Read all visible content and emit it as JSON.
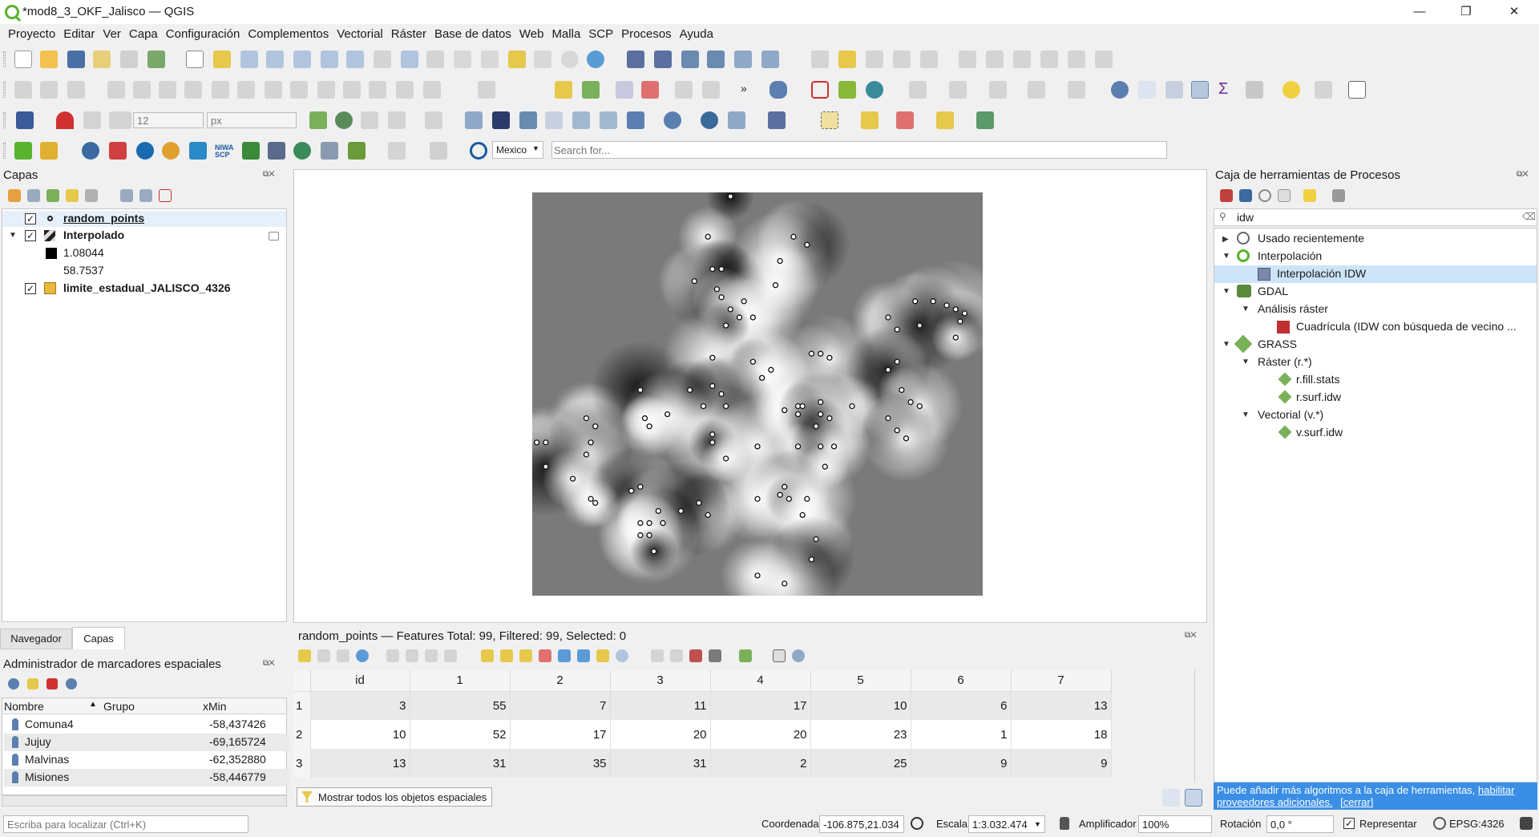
{
  "window": {
    "title": "*mod8_3_OKF_Jalisco — QGIS",
    "controls": [
      "—",
      "❐",
      "✕"
    ]
  },
  "menu": [
    "Proyecto",
    "Editar",
    "Ver",
    "Capa",
    "Configuración",
    "Complementos",
    "Vectorial",
    "Ráster",
    "Base de datos",
    "Web",
    "Malla",
    "SCP",
    "Procesos",
    "Ayuda"
  ],
  "toolbar": {
    "size_value": "12",
    "unit_value": "px",
    "locator_region": "Mexico",
    "search_placeholder": "Search for...",
    "overflow": "»"
  },
  "layers_panel": {
    "title": "Capas",
    "layers": [
      {
        "name": "random_points",
        "checked": true,
        "type": "points"
      },
      {
        "name": "Interpolado",
        "checked": true,
        "type": "raster",
        "legend": [
          "1.08044",
          "58.7537"
        ]
      },
      {
        "name": "limite_estadual_JALISCO_4326",
        "checked": true,
        "type": "polygon",
        "color": "#e8b93a"
      }
    ]
  },
  "bottom_tabs": [
    "Navegador",
    "Capas"
  ],
  "bookmarks_panel": {
    "title": "Administrador de marcadores espaciales",
    "columns": [
      "Nombre",
      "Grupo",
      "xMin"
    ],
    "rows": [
      {
        "name": "Comuna4",
        "group": "",
        "xmin": "-58,437426"
      },
      {
        "name": "Jujuy",
        "group": "",
        "xmin": "-69,165724"
      },
      {
        "name": "Malvinas",
        "group": "",
        "xmin": "-62,352880"
      },
      {
        "name": "Misiones",
        "group": "",
        "xmin": "-58,446779"
      }
    ]
  },
  "attribute_table": {
    "title": "random_points — Features Total: 99, Filtered: 99, Selected: 0",
    "columns": [
      "id",
      "1",
      "2",
      "3",
      "4",
      "5",
      "6",
      "7"
    ],
    "rows": [
      {
        "rownum": "1",
        "cells": [
          "3",
          "55",
          "7",
          "11",
          "17",
          "10",
          "6",
          "13"
        ]
      },
      {
        "rownum": "2",
        "cells": [
          "10",
          "52",
          "17",
          "20",
          "20",
          "23",
          "1",
          "18"
        ]
      },
      {
        "rownum": "3",
        "cells": [
          "13",
          "31",
          "35",
          "31",
          "2",
          "25",
          "9",
          "9"
        ]
      }
    ],
    "filter_button": "Mostrar todos los objetos espaciales"
  },
  "processing": {
    "title": "Caja de herramientas de Procesos",
    "search_value": "idw",
    "tree": [
      {
        "label": "Usado recientemente",
        "level": 0,
        "expanded": false
      },
      {
        "label": "Interpolación",
        "level": 0,
        "expanded": true
      },
      {
        "label": "Interpolación IDW",
        "level": 1
      },
      {
        "label": "GDAL",
        "level": 0,
        "expanded": true
      },
      {
        "label": "Análisis ráster",
        "level": 1,
        "expanded": true
      },
      {
        "label": "Cuadrícula (IDW con búsqueda de vecino ...",
        "level": 2
      },
      {
        "label": "GRASS",
        "level": 0,
        "expanded": true
      },
      {
        "label": "Ráster (r.*)",
        "level": 1,
        "expanded": true
      },
      {
        "label": "r.fill.stats",
        "level": 2
      },
      {
        "label": "r.surf.idw",
        "level": 2
      },
      {
        "label": "Vectorial (v.*)",
        "level": 1,
        "expanded": true
      },
      {
        "label": "v.surf.idw",
        "level": 2
      }
    ],
    "notice_text": "Puede añadir más algoritmos a la caja de herramientas,",
    "notice_link1": "habilitar",
    "notice_link2": "proveedores adicionales.",
    "notice_close": "[cerrar]"
  },
  "statusbar": {
    "locator_placeholder": "Escriba para localizar (Ctrl+K)",
    "coord_label": "Coordenada",
    "coord_value": "-106.875,21.034",
    "scale_label": "Escala",
    "scale_value": "1:3.032.474",
    "magnifier_label": "Amplificador",
    "magnifier_value": "100%",
    "rotation_label": "Rotación",
    "rotation_value": "0,0 °",
    "render_label": "Representar",
    "crs": "EPSG:4326"
  },
  "map": {
    "points": [
      [
        0.44,
        0.01
      ],
      [
        0.39,
        0.11
      ],
      [
        0.58,
        0.11
      ],
      [
        0.61,
        0.13
      ],
      [
        0.55,
        0.17
      ],
      [
        0.4,
        0.19
      ],
      [
        0.42,
        0.19
      ],
      [
        0.36,
        0.22
      ],
      [
        0.54,
        0.23
      ],
      [
        0.41,
        0.24
      ],
      [
        0.47,
        0.27
      ],
      [
        0.42,
        0.26
      ],
      [
        0.44,
        0.29
      ],
      [
        0.46,
        0.31
      ],
      [
        0.49,
        0.31
      ],
      [
        0.43,
        0.33
      ],
      [
        0.85,
        0.27
      ],
      [
        0.89,
        0.27
      ],
      [
        0.92,
        0.28
      ],
      [
        0.94,
        0.29
      ],
      [
        0.96,
        0.3
      ],
      [
        0.95,
        0.32
      ],
      [
        0.79,
        0.31
      ],
      [
        0.81,
        0.34
      ],
      [
        0.86,
        0.33
      ],
      [
        0.94,
        0.36
      ],
      [
        0.62,
        0.4
      ],
      [
        0.64,
        0.4
      ],
      [
        0.66,
        0.41
      ],
      [
        0.4,
        0.41
      ],
      [
        0.49,
        0.42
      ],
      [
        0.81,
        0.42
      ],
      [
        0.53,
        0.44
      ],
      [
        0.79,
        0.44
      ],
      [
        0.51,
        0.46
      ],
      [
        0.82,
        0.49
      ],
      [
        0.4,
        0.48
      ],
      [
        0.42,
        0.5
      ],
      [
        0.38,
        0.53
      ],
      [
        0.43,
        0.53
      ],
      [
        0.64,
        0.52
      ],
      [
        0.71,
        0.53
      ],
      [
        0.84,
        0.52
      ],
      [
        0.86,
        0.53
      ],
      [
        0.59,
        0.53
      ],
      [
        0.6,
        0.53
      ],
      [
        0.56,
        0.54
      ],
      [
        0.59,
        0.55
      ],
      [
        0.64,
        0.55
      ],
      [
        0.66,
        0.56
      ],
      [
        0.79,
        0.56
      ],
      [
        0.63,
        0.58
      ],
      [
        0.12,
        0.56
      ],
      [
        0.14,
        0.58
      ],
      [
        0.24,
        0.49
      ],
      [
        0.25,
        0.56
      ],
      [
        0.26,
        0.58
      ],
      [
        0.81,
        0.59
      ],
      [
        0.83,
        0.61
      ],
      [
        0.4,
        0.6
      ],
      [
        0.4,
        0.62
      ],
      [
        0.01,
        0.62
      ],
      [
        0.03,
        0.62
      ],
      [
        0.13,
        0.62
      ],
      [
        0.5,
        0.63
      ],
      [
        0.59,
        0.63
      ],
      [
        0.64,
        0.63
      ],
      [
        0.67,
        0.63
      ],
      [
        0.12,
        0.65
      ],
      [
        0.03,
        0.68
      ],
      [
        0.65,
        0.68
      ],
      [
        0.09,
        0.71
      ],
      [
        0.56,
        0.73
      ],
      [
        0.5,
        0.76
      ],
      [
        0.55,
        0.75
      ],
      [
        0.57,
        0.76
      ],
      [
        0.13,
        0.76
      ],
      [
        0.24,
        0.73
      ],
      [
        0.22,
        0.74
      ],
      [
        0.61,
        0.76
      ],
      [
        0.14,
        0.77
      ],
      [
        0.37,
        0.77
      ],
      [
        0.39,
        0.8
      ],
      [
        0.28,
        0.79
      ],
      [
        0.33,
        0.79
      ],
      [
        0.24,
        0.82
      ],
      [
        0.26,
        0.82
      ],
      [
        0.29,
        0.82
      ],
      [
        0.24,
        0.85
      ],
      [
        0.26,
        0.85
      ],
      [
        0.27,
        0.89
      ],
      [
        0.6,
        0.8
      ],
      [
        0.63,
        0.86
      ],
      [
        0.62,
        0.91
      ],
      [
        0.56,
        0.97
      ],
      [
        0.43,
        0.66
      ],
      [
        0.35,
        0.49
      ],
      [
        0.5,
        0.95
      ],
      [
        0.3,
        0.55
      ]
    ]
  }
}
